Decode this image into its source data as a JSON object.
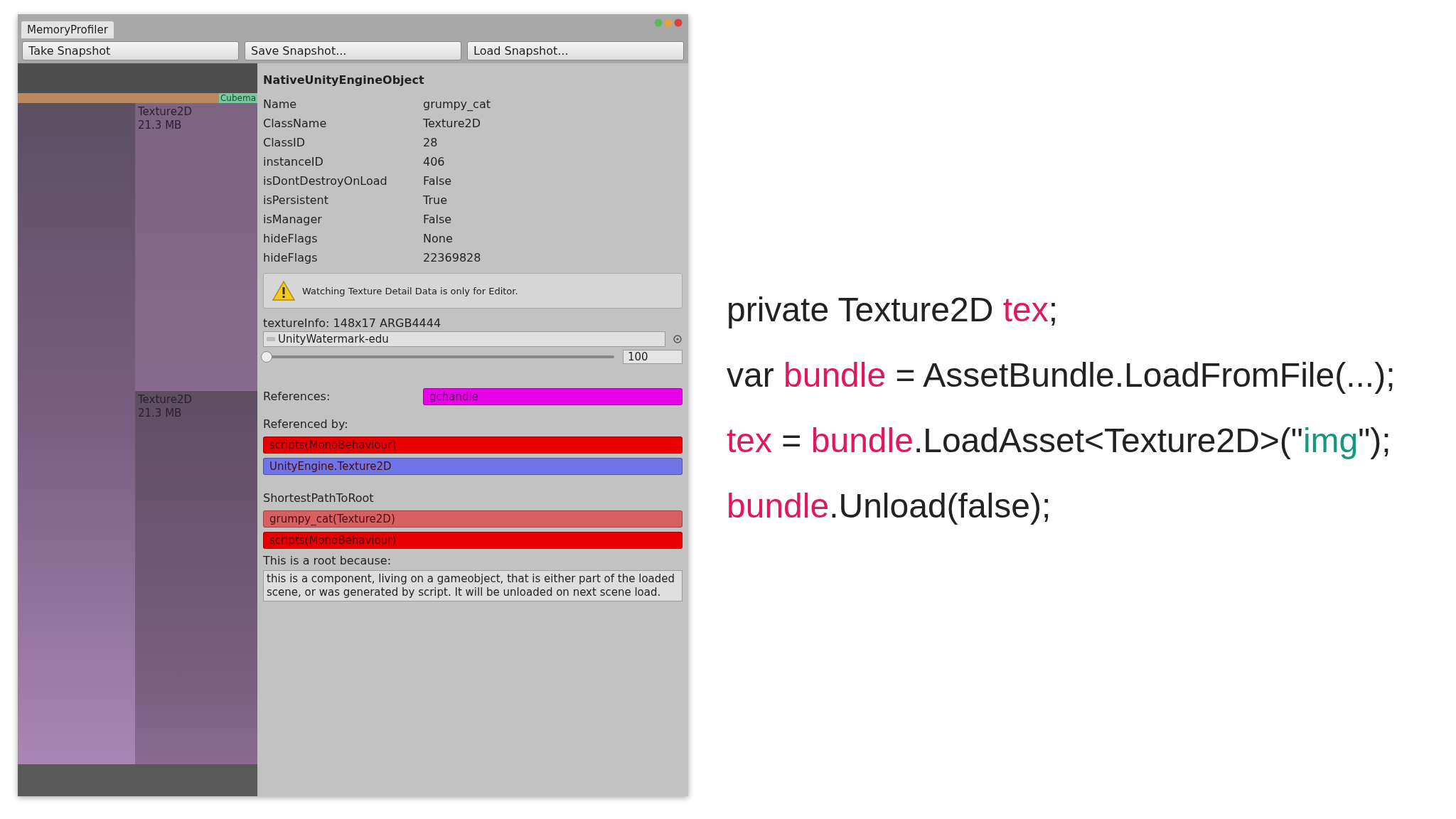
{
  "window": {
    "tab": "MemoryProfiler"
  },
  "toolbar": [
    "Take Snapshot",
    "Save Snapshot...",
    "Load Snapshot..."
  ],
  "treemap": {
    "cut_label": "Cubema",
    "cells": [
      {
        "label": "Texture2D",
        "size": "21.3 MB"
      },
      {
        "label": "Texture2D",
        "size": "21.3 MB"
      }
    ]
  },
  "inspector": {
    "heading": "NativeUnityEngineObject",
    "properties": [
      {
        "name": "Name",
        "value": "grumpy_cat"
      },
      {
        "name": "ClassName",
        "value": "Texture2D"
      },
      {
        "name": "ClassID",
        "value": "28"
      },
      {
        "name": "instanceID",
        "value": "406"
      },
      {
        "name": "isDontDestroyOnLoad",
        "value": "False"
      },
      {
        "name": "isPersistent",
        "value": "True"
      },
      {
        "name": "isManager",
        "value": "False"
      },
      {
        "name": "hideFlags",
        "value": "None"
      },
      {
        "name": "hideFlags",
        "value": "22369828"
      }
    ],
    "warning": "Watching Texture Detail Data is only for Editor.",
    "texture_info": "textureInfo: 148x17 ARGB4444",
    "texture_field": "UnityWatermark-edu",
    "zoom": {
      "level": 0.01,
      "reading": "100"
    },
    "references_label": "References:",
    "references": [
      {
        "label": "gchandle",
        "color": "#e800e8"
      }
    ],
    "referenced_by_label": "Referenced by:",
    "referenced_by": [
      {
        "label": "scripts(MonoBehaviour)",
        "color": "#e80000"
      },
      {
        "label": "UnityEngine.Texture2D",
        "color": "#6f74e6"
      }
    ],
    "path_label": "ShortestPathToRoot",
    "path": [
      {
        "label": "grumpy_cat(Texture2D)",
        "color": "#d86060"
      },
      {
        "label": "scripts(MonoBehaviour)",
        "color": "#e80000"
      }
    ],
    "root_label": "This is a root because:",
    "root_reason": "this is a component, living on a gameobject, that is either part of the loaded scene, or was generated by script. It will be unloaded on next scene load."
  },
  "code": [
    [
      {
        "kind": "plain",
        "text": "private Texture2D "
      },
      {
        "kind": "ident",
        "text": "tex"
      },
      {
        "kind": "plain",
        "text": ";"
      }
    ],
    [
      {
        "kind": "plain",
        "text": "var "
      },
      {
        "kind": "ident",
        "text": "bundle"
      },
      {
        "kind": "plain",
        "text": " = AssetBundle.LoadFromFile(...);"
      }
    ],
    [
      {
        "kind": "ident",
        "text": "tex"
      },
      {
        "kind": "plain",
        "text": " = "
      },
      {
        "kind": "ident",
        "text": "bundle"
      },
      {
        "kind": "plain",
        "text": ".LoadAsset<Texture2D>(\""
      },
      {
        "kind": "string",
        "text": "img"
      },
      {
        "kind": "plain",
        "text": "\");"
      }
    ],
    [
      {
        "kind": "ident",
        "text": "bundle"
      },
      {
        "kind": "plain",
        "text": ".Unload(false);"
      }
    ]
  ]
}
